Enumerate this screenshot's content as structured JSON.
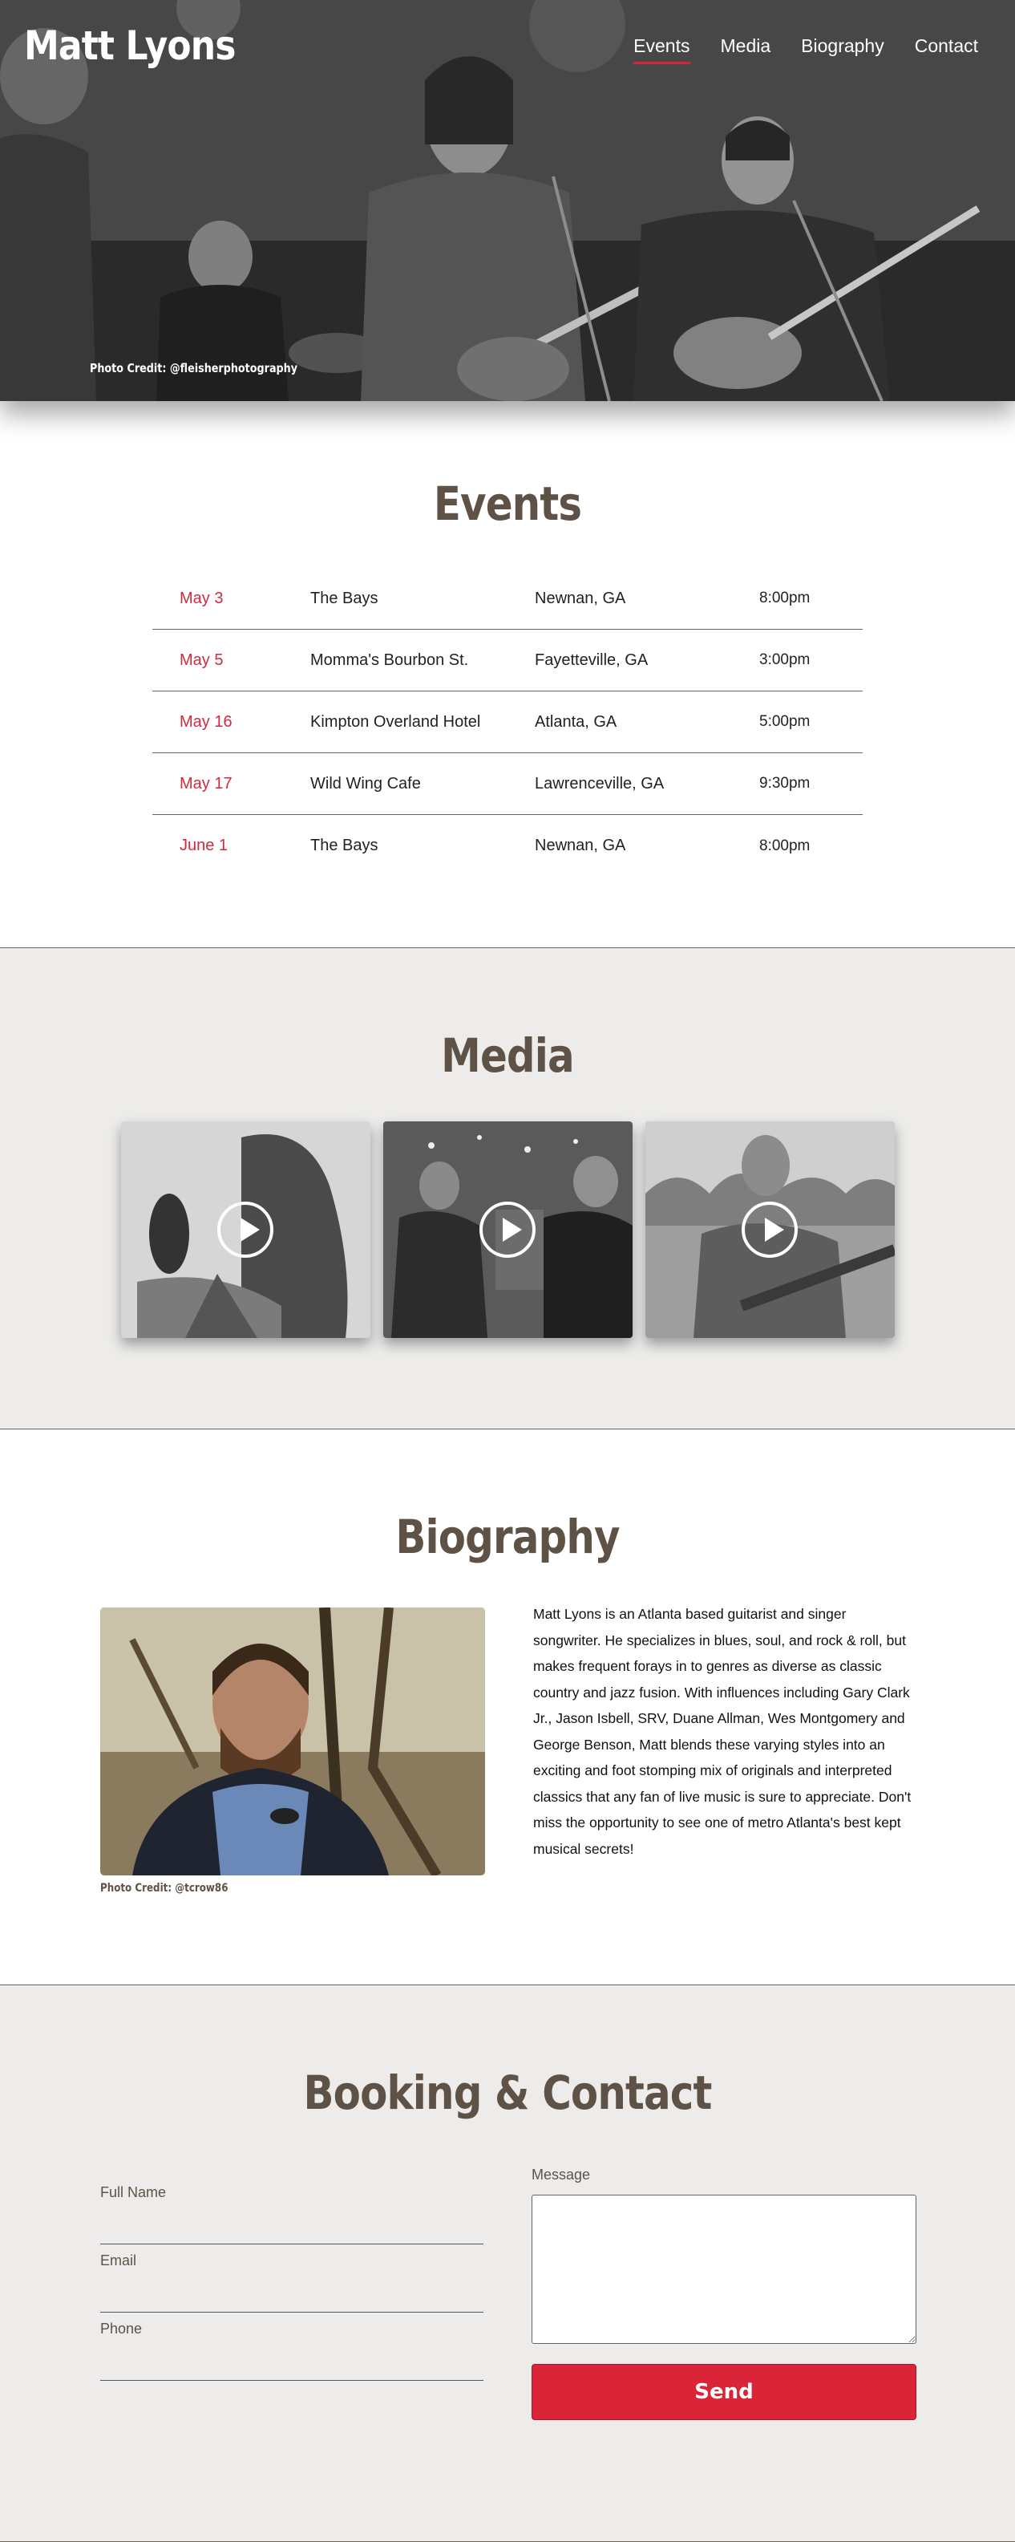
{
  "header": {
    "site_title": "Matt Lyons",
    "nav": [
      "Events",
      "Media",
      "Biography",
      "Contact"
    ],
    "photo_credit": "Photo Credit: @fleisherphotography"
  },
  "events": {
    "title": "Events",
    "rows": [
      {
        "date": "May 3",
        "venue": "The Bays",
        "city": "Newnan, GA",
        "time": "8:00pm"
      },
      {
        "date": "May 5",
        "venue": "Momma's Bourbon St.",
        "city": "Fayetteville, GA",
        "time": "3:00pm"
      },
      {
        "date": "May 16",
        "venue": "Kimpton Overland Hotel",
        "city": "Atlanta, GA",
        "time": "5:00pm"
      },
      {
        "date": "May 17",
        "venue": "Wild Wing Cafe",
        "city": "Lawrenceville, GA",
        "time": "9:30pm"
      },
      {
        "date": "June 1",
        "venue": "The Bays",
        "city": "Newnan, GA",
        "time": "8:00pm"
      }
    ]
  },
  "media": {
    "title": "Media",
    "videos": [
      {
        "icon": "play-icon"
      },
      {
        "icon": "play-icon"
      },
      {
        "icon": "play-icon"
      }
    ]
  },
  "biography": {
    "title": "Biography",
    "photo_credit": "Photo Credit: @tcrow86",
    "text": "Matt Lyons is an Atlanta based guitarist and singer songwriter. He specializes in blues, soul, and rock & roll, but makes frequent forays in to genres as diverse as classic country and jazz fusion. With influences including Gary Clark Jr., Jason Isbell, SRV, Duane Allman, Wes Montgomery and George Benson, Matt blends these varying styles into an exciting and foot stomping mix of originals and interpreted classics that any fan of live music is sure to appreciate. Don't miss the opportunity to see one of metro Atlanta's best kept musical secrets!"
  },
  "contact": {
    "title": "Booking & Contact",
    "fields": {
      "full_name": "Full Name",
      "email": "Email",
      "phone": "Phone",
      "message": "Message"
    },
    "send_label": "Send"
  },
  "colors": {
    "accent": "#da2438",
    "heading": "#5e5247",
    "section_bg": "#edecea"
  }
}
